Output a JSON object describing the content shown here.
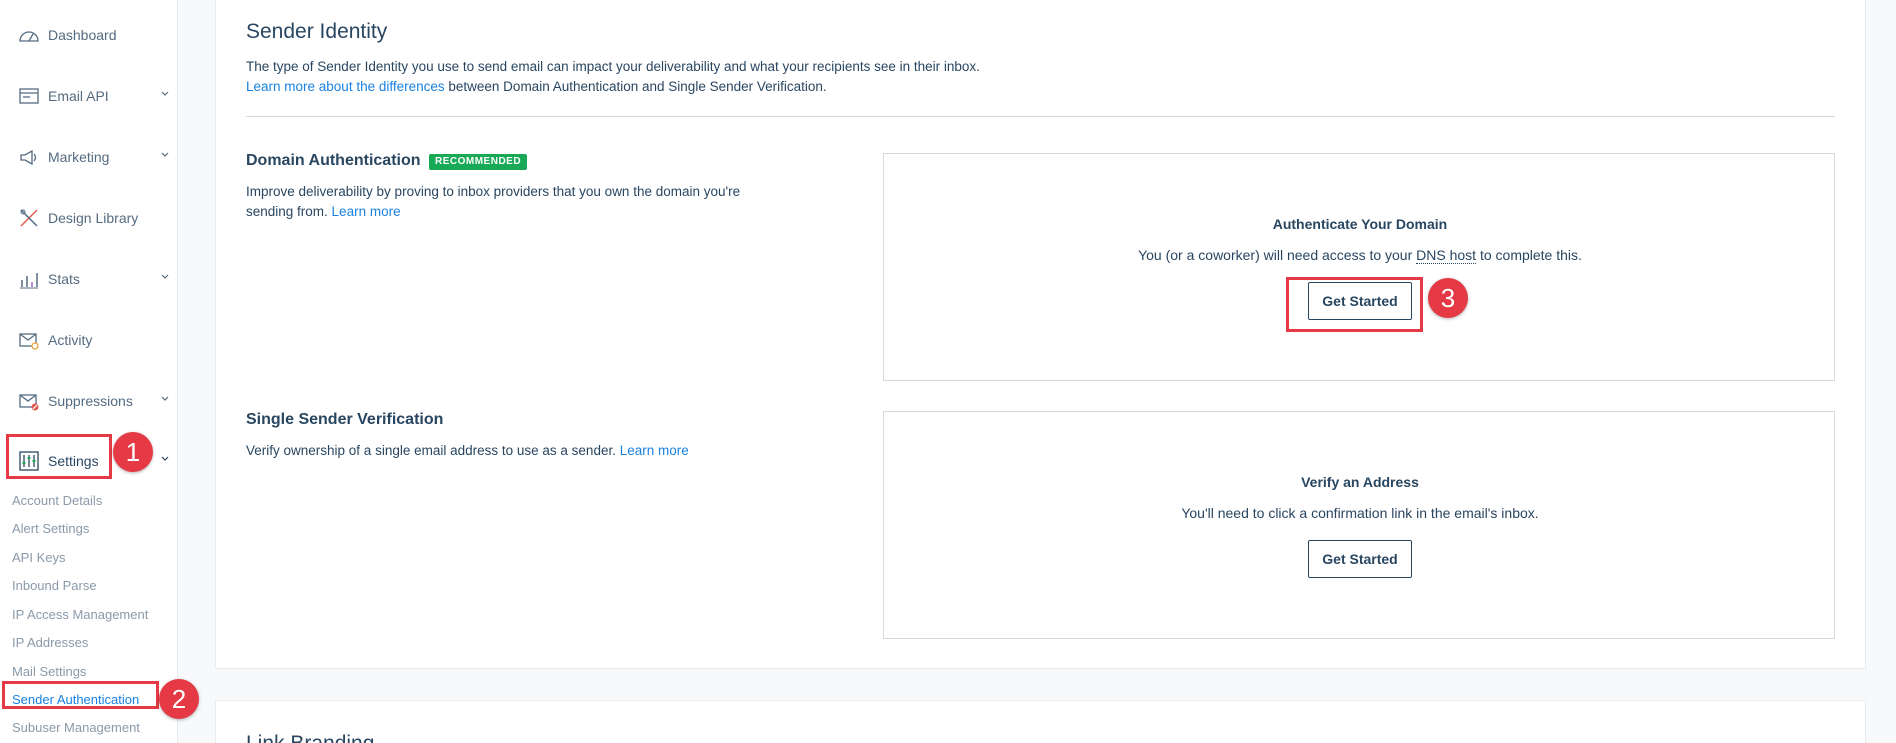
{
  "sidebar": {
    "items": [
      {
        "label": "Dashboard",
        "icon": "dashboard-icon"
      },
      {
        "label": "Email API",
        "icon": "email-api-icon"
      },
      {
        "label": "Marketing",
        "icon": "marketing-icon"
      },
      {
        "label": "Design Library",
        "icon": "design-library-icon"
      },
      {
        "label": "Stats",
        "icon": "stats-icon"
      },
      {
        "label": "Activity",
        "icon": "activity-icon"
      },
      {
        "label": "Suppressions",
        "icon": "suppressions-icon"
      },
      {
        "label": "Settings",
        "icon": "settings-icon"
      }
    ],
    "sub_items": [
      "Account Details",
      "Alert Settings",
      "API Keys",
      "Inbound Parse",
      "IP Access Management",
      "IP Addresses",
      "Mail Settings",
      "Sender Authentication",
      "Subuser Management"
    ]
  },
  "sender_identity": {
    "title": "Sender Identity",
    "description": "The type of Sender Identity you use to send email can impact your deliverability and what your recipients see in their inbox.",
    "learn_link": "Learn more about the differences",
    "learn_tail": " between Domain Authentication and Single Sender Verification."
  },
  "domain_auth": {
    "title": "Domain Authentication",
    "badge": "RECOMMENDED",
    "description_line1": "Improve deliverability by proving to inbox providers that you own the domain you're",
    "description_line2": "sending from. ",
    "learn_more": "Learn more",
    "box_title": "Authenticate Your Domain",
    "box_desc_pre": "You (or a coworker) will need access to your ",
    "box_desc_term": "DNS host",
    "box_desc_post": " to complete this.",
    "button": "Get Started"
  },
  "single_sender": {
    "title": "Single Sender Verification",
    "description": "Verify ownership of a single email address to use as a sender. ",
    "learn_more": "Learn more",
    "box_title": "Verify an Address",
    "box_desc": "You'll need to click a confirmation link in the email's inbox.",
    "button": "Get Started"
  },
  "link_branding": {
    "title": "Link Branding"
  },
  "annotations": {
    "step1": "1",
    "step2": "2",
    "step3": "3",
    "color": "#e53945"
  },
  "colors": {
    "link": "#1a82e2",
    "text": "#294661",
    "badge": "#18a957"
  }
}
